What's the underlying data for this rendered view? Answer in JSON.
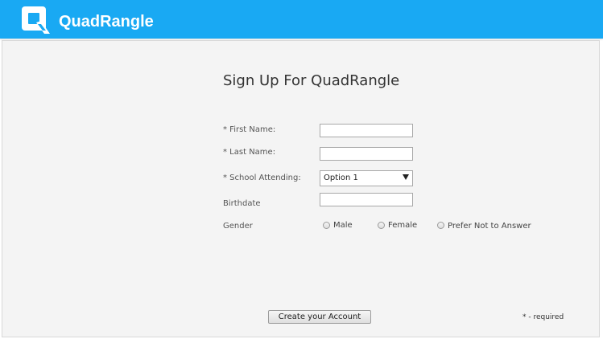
{
  "header": {
    "brand": "QuadRangle",
    "logo_icon": "quadrangle-q-logo-icon",
    "background": "#19a9f3"
  },
  "form": {
    "title": "Sign Up For QuadRangle",
    "first_name_label": "* First Name:",
    "first_name_value": "",
    "last_name_label": "* Last Name:",
    "last_name_value": "",
    "school_label": "* School Attending:",
    "school_selected": "Option 1",
    "birthdate_label": "Birthdate",
    "birthdate_value": "",
    "gender_label": "Gender",
    "gender_options": [
      "Male",
      "Female",
      "Prefer Not to Answer"
    ],
    "submit_label": "Create your Account",
    "required_note": "* - required"
  }
}
